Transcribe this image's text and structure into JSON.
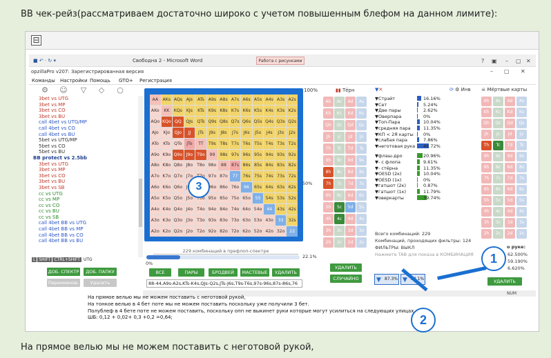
{
  "post": {
    "intro_text": "BB чек-рейз(рассматриваем достаточно широко с учетом повышенным блефом на данном лимите):",
    "outro_text": "На прямое велью мы не можем поставить с неготовой рукой,"
  },
  "spoiler": {
    "toggle_symbol": "⊟"
  },
  "word": {
    "title": "Свободна 2 - Microsoft Word",
    "context_tab": "Работа с рисунками"
  },
  "app": {
    "title": "opzillaPro v207: Зарегистрированная версия",
    "menu": [
      "Команды",
      "Настройки",
      "Помощь",
      "GTO+",
      "Регистрация"
    ]
  },
  "tree": {
    "items": [
      {
        "label": "3bet vs UTG",
        "color": "#c0392b"
      },
      {
        "label": "3bet vs MP",
        "color": "#c0392b"
      },
      {
        "label": "3bet vs CO",
        "color": "#c0392b"
      },
      {
        "label": "3bet vs BU",
        "color": "#c0392b"
      },
      {
        "label": "call 4bet vs UTG/MP",
        "color": "#2a56c6"
      },
      {
        "label": "call 4bet vs CO",
        "color": "#2a56c6"
      },
      {
        "label": "call 4bet vs BU",
        "color": "#2a56c6"
      },
      {
        "label": "5bet vs UTG/MP",
        "color": "#333333"
      },
      {
        "label": "5bet vs CO",
        "color": "#333333"
      },
      {
        "label": "5bet vs BU",
        "color": "#333333"
      },
      {
        "label": "BB protect vs 2.5bb",
        "color": "#1f3f8f",
        "bold": true
      },
      {
        "label": "3bet vs UTG",
        "color": "#c0392b"
      },
      {
        "label": "3bet vs MP",
        "color": "#c0392b"
      },
      {
        "label": "3bet vs CO",
        "color": "#c0392b"
      },
      {
        "label": "3bet vs BU",
        "color": "#c0392b"
      },
      {
        "label": "3bet vs SB",
        "color": "#c0392b"
      },
      {
        "label": "cc vs UTG",
        "color": "#2e8b2e"
      },
      {
        "label": "cc vs MP",
        "color": "#2e8b2e"
      },
      {
        "label": "cc vs CO",
        "color": "#2e8b2e"
      },
      {
        "label": "cc vs BU",
        "color": "#2e8b2e"
      },
      {
        "label": "cc vs SB",
        "color": "#2e8b2e"
      },
      {
        "label": "call 4bet BB vs UTG",
        "color": "#2a56c6"
      },
      {
        "label": "call 4bet BB vs MP",
        "color": "#2a56c6"
      },
      {
        "label": "call 4bet BB vs CO",
        "color": "#2a56c6"
      },
      {
        "label": "call 4bet BB vs BU",
        "color": "#2a56c6"
      }
    ],
    "keys": [
      "L",
      "SHIFT",
      "CTRL+SHIFT",
      "UTG"
    ]
  },
  "grid": {
    "ranks": [
      "A",
      "K",
      "Q",
      "J",
      "T",
      "9",
      "8",
      "7",
      "6",
      "5",
      "4",
      "3",
      "2"
    ],
    "palette": {
      "s": "#f2d46a",
      "p": "#f5c0b8",
      "o": "#f7d7d0",
      "red": "#d9522a",
      "blue": "#7fb0e8",
      "pink": "#f4a8a8"
    },
    "special": {
      "QQ": "red",
      "KQo": "red",
      "QJs": "s",
      "JJ": "red",
      "QJo": "red",
      "JTo": "pink",
      "J9o": "red",
      "Q9o": "red",
      "77": "blue",
      "66": "blue",
      "55": "blue",
      "44": "blue",
      "33": "blue",
      "22": "blue",
      "T9o": "red",
      "87s": "pink"
    }
  },
  "range_panel": {
    "percent_top": "100%",
    "combos_label": "229 комбинаций в префлоп-спектре",
    "percent_side": "50%",
    "slider_pct": "22.1%",
    "slider_fill": 0.221,
    "zero": "0%"
  },
  "buttons": {
    "all": "ВСЕ",
    "pairs": "ПАРЫ",
    "broadway": "БРОДВЕЙ",
    "suited": "МАСТЕВЫЕ",
    "delete": "УДАЛИТЬ",
    "add_range": "ДОБ. СПЕКТР",
    "add_folder": "ДОБ. ПАПКУ",
    "rename": "Переименов.",
    "remove": "Удалить",
    "delete2": "УДАЛИТЬ",
    "random": "СЛУЧАЙНО",
    "delete3": "УДАЛИТЬ"
  },
  "range_text": "88-44,A9s-A2s,KTs-K4s,QJs-Q2s,JTs-J6s,T9s-T6s,97s-96s,87s-86s,76",
  "turn": {
    "title": "Тёрн"
  },
  "stats": {
    "title": "Инв",
    "rows": [
      {
        "label": "Стрэйт",
        "val": "16.16%",
        "fill": 0.16,
        "color": "#2c5fc2"
      },
      {
        "label": "Сет",
        "val": "5.24%",
        "fill": 0.05,
        "color": "#2c5fc2"
      },
      {
        "label": "Две пары",
        "val": "2.62%",
        "fill": 0.03,
        "color": "#2c5fc2"
      },
      {
        "label": "Оверпара",
        "val": "0%",
        "fill": 0,
        "color": "#2c5fc2"
      },
      {
        "label": "Топ-Пара",
        "val": "10.04%",
        "fill": 0.1,
        "color": "#2c5fc2"
      },
      {
        "label": "средняя пара",
        "val": "11.35%",
        "fill": 0.11,
        "color": "#2c5fc2"
      },
      {
        "label": "КП < 2Я карты",
        "val": "0%",
        "fill": 0,
        "color": "#2c5fc2"
      },
      {
        "label": "слабая пара",
        "val": "7.86%",
        "fill": 0.08,
        "color": "#2c5fc2"
      },
      {
        "label": "неготовая рука",
        "val": "46.72%",
        "fill": 0.47,
        "color": "#2c5fc2"
      },
      {
        "label": "флаш-дро",
        "val": "20.96%",
        "fill": 0.21,
        "color": "#3a9a2a"
      },
      {
        "label": "- с флопа",
        "val": "9.61%",
        "fill": 0.1,
        "color": "#3a9a2a"
      },
      {
        "label": "- стёрна",
        "val": "11.35%",
        "fill": 0.11,
        "color": "#3a9a2a"
      },
      {
        "label": "OESD (2к)",
        "val": "10.04%",
        "fill": 0.1,
        "color": "#3a9a2a"
      },
      {
        "label": "OESD (1к)",
        "val": "0%",
        "fill": 0,
        "color": "#3a9a2a"
      },
      {
        "label": "гатшот (2к)",
        "val": "0.87%",
        "fill": 0.01,
        "color": "#3a9a2a"
      },
      {
        "label": "гатшот (1к)",
        "val": "11.79%",
        "fill": 0.12,
        "color": "#3a9a2a"
      },
      {
        "label": "оверкарты",
        "val": "39.74%",
        "fill": 0.4,
        "color": "#3a9a2a"
      }
    ],
    "total": "Всего комбинаций: 229",
    "passing": "Комбинаций, проходящих фильтры: 124",
    "filters": "ФИЛЬТРЫ: ВЫКЛ",
    "hint": "Нажмите TAB для показа в КОМБИНАЦИЯ"
  },
  "dead": {
    "title": "Мёртвые карты",
    "per_hand": "о руке:",
    "v1": "62.500%",
    "v2": "59.190%",
    "v3": "6.620%"
  },
  "filter_buttons": [
    {
      "label": "87.3%"
    },
    {
      "label": "54.1%"
    }
  ],
  "doc": {
    "lines": [
      "На прямое велью мы не можем поставить с неготовой рукой,",
      "На тонкое велью в 4 бет поте мы не можем поставить поскольку уже получили 3 бет.",
      "Полублеф в 4 бете поте  не можем поставить, поскольку опп не выкинет руки которые могут усилиться на следующих улицах.",
      "ШБ: 0,12 + 0,02+  0,3 +0,2 =0,64;"
    ],
    "num": "NUM"
  },
  "badges": {
    "one": "1",
    "two": "2",
    "three": "3"
  }
}
